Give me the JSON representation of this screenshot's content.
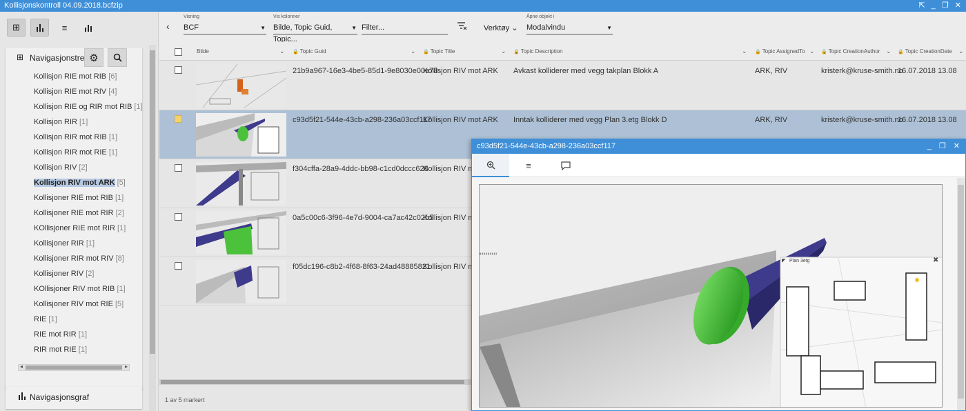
{
  "window": {
    "title": "Kollisjonskontroll 04.09.2018.bcfzip"
  },
  "view_buttons": [
    {
      "icon": "tree-icon",
      "glyph": "⊞"
    },
    {
      "icon": "bar-chart-icon",
      "glyph": "▮"
    },
    {
      "icon": "list-icon",
      "glyph": "≡"
    },
    {
      "icon": "chart-icon",
      "glyph": "▮"
    }
  ],
  "nav": {
    "title": "Navigasjonstre",
    "items": [
      {
        "label": "Kollisjon RIE mot RIB",
        "count": "[6]"
      },
      {
        "label": "Kollisjon RIE mot RIV",
        "count": "[4]"
      },
      {
        "label": "Kollisjon RIE og RIR mot RIB",
        "count": "[1]"
      },
      {
        "label": "Kollisjon RIR",
        "count": "[1]"
      },
      {
        "label": "Kollisjon RIR mot RIB",
        "count": "[1]"
      },
      {
        "label": "Kollisjon RIR mot RIE",
        "count": "[1]"
      },
      {
        "label": "Kollisjon RIV",
        "count": "[2]"
      },
      {
        "label": "Kollisjon RIV mot ARK",
        "count": "[5]"
      },
      {
        "label": "Kollisjoner RIE mot RIB",
        "count": "[1]"
      },
      {
        "label": "Kollisjoner RIE mot RIR",
        "count": "[2]"
      },
      {
        "label": "KOllisjoner RIE mot RIR",
        "count": "[1]"
      },
      {
        "label": "Kollisjoner RIR",
        "count": "[1]"
      },
      {
        "label": "Kollisjoner RIR mot RIV",
        "count": "[8]"
      },
      {
        "label": "Kollisjoner RIV",
        "count": "[2]"
      },
      {
        "label": "KOllisjoner RIV mot RIB",
        "count": "[1]"
      },
      {
        "label": "Kollisjoner RIV mot RIE",
        "count": "[5]"
      },
      {
        "label": "RIE",
        "count": "[1]"
      },
      {
        "label": "RIE mot RIR",
        "count": "[1]"
      },
      {
        "label": "RIR mot RIE",
        "count": "[1]"
      }
    ],
    "graph_title": "Navigasjonsgraf"
  },
  "toolbar": {
    "visning_label": "Visning",
    "visning_value": "BCF",
    "vis_kolonner_label": "Vis kolonner",
    "vis_kolonner_value": "Bilde, Topic Guid, Topic...",
    "filter_placeholder": "Filter...",
    "verktoy_label": "Verktøy",
    "apne_label": "Åpne objekt i",
    "apne_value": "Modalvindu"
  },
  "table": {
    "columns": [
      "Bilde",
      "Topic Guid",
      "Topic Title",
      "Topic Description",
      "Topic AssignedTo",
      "Topic CreationAuthor",
      "Topic CreationDate"
    ],
    "rows": [
      {
        "guid": "21b9a967-16e3-4be5-85d1-9e8030e00e78",
        "title": "Kollisjon RIV mot ARK",
        "description": "Avkast kolliderer med vegg takplan Blokk A",
        "assigned": "ARK, RIV",
        "author": "kristerk@kruse-smith.no",
        "date": "16.07.2018 13.08",
        "checked": false
      },
      {
        "guid": "c93d5f21-544e-43cb-a298-236a03ccf117",
        "title": "Kollisjon RIV mot ARK",
        "description": "Inntak kolliderer med vegg Plan 3.etg Blokk D",
        "assigned": "ARK, RIV",
        "author": "kristerk@kruse-smith.no",
        "date": "16.07.2018 13.08",
        "checked": true
      },
      {
        "guid": "f304cffa-28a9-4ddc-bb98-c1cd0dccc628",
        "title": "Kollisjon RIV mo",
        "description": "",
        "assigned": "",
        "author": "",
        "date": "",
        "checked": false
      },
      {
        "guid": "0a5c00c6-3f96-4e7d-9004-ca7ac42c02b5",
        "title": "Kollisjon RIV mo",
        "description": "",
        "assigned": "",
        "author": "",
        "date": "",
        "checked": false
      },
      {
        "guid": "f05dc196-c8b2-4f68-8f63-24ad48885821",
        "title": "Kollisjon RIV mo",
        "description": "",
        "assigned": "",
        "author": "",
        "date": "",
        "checked": false
      }
    ],
    "selection_count": "1 av 5 markert"
  },
  "modal": {
    "title": "c93d5f21-544e-43cb-a298-236a03ccf117",
    "tabs": [
      {
        "icon": "zoom-icon",
        "glyph": "⌕"
      },
      {
        "icon": "list-icon",
        "glyph": "≡"
      },
      {
        "icon": "comment-icon",
        "glyph": "▭"
      }
    ],
    "minimap_label": "Plan 3etg"
  },
  "colors": {
    "accent": "#3f8fd8",
    "selected_row": "#adc0d5",
    "duct": "#3e3a8c",
    "collision": "#4cc13c"
  }
}
